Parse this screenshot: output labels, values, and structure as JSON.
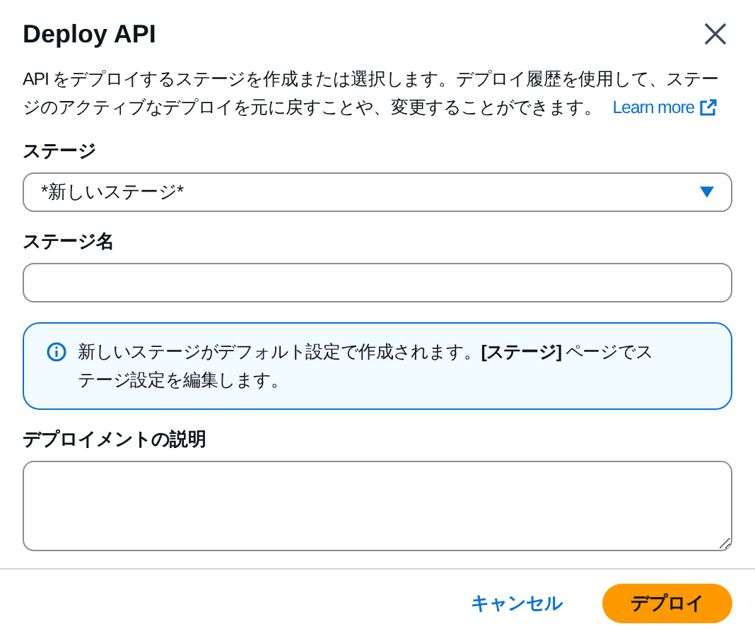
{
  "dialog": {
    "title": "Deploy API",
    "description": "API をデプロイするステージを作成または選択します。デプロイ履歴を使用して、ステージのアクティブなデプロイを元に戻すことや、変更することができます。",
    "learn_more": "Learn more"
  },
  "stage": {
    "label": "ステージ",
    "value": "*新しいステージ*"
  },
  "stage_name": {
    "label": "ステージ名"
  },
  "info": {
    "text": "新しいステージがデフォルト設定で作成されます。**[ステージ]** ページでステージ設定を編集します。"
  },
  "description_field": {
    "label": "デプロイメントの説明"
  },
  "buttons": [
    {
      "label": "キャンセル",
      "kind": "link"
    },
    {
      "label": "デプロイ",
      "kind": "primary"
    }
  ]
}
